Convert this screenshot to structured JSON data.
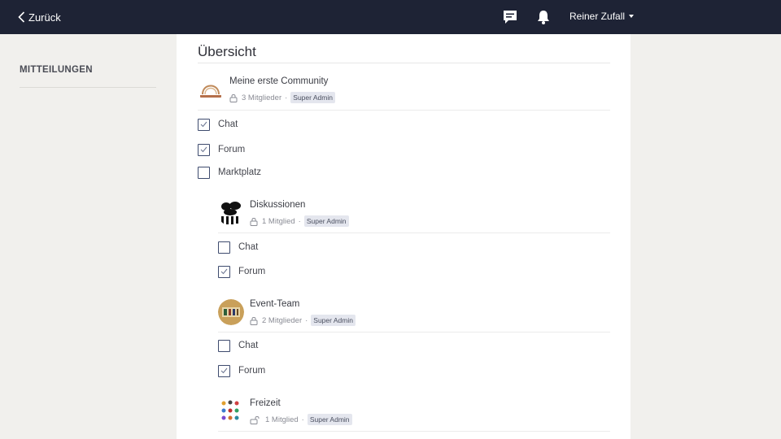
{
  "header": {
    "back_label": "Zurück",
    "user_name": "Reiner Zufall"
  },
  "sidebar": {
    "title": "MITTEILUNGEN"
  },
  "main": {
    "title": "Übersicht",
    "communities": [
      {
        "name": "Meine erste Community",
        "members": "3 Mitglieder",
        "role": "Super Admin",
        "options": [
          {
            "label": "Chat",
            "checked": true
          },
          {
            "label": "Forum",
            "checked": true
          },
          {
            "label": "Marktplatz",
            "checked": false
          }
        ]
      },
      {
        "name": "Diskussionen",
        "members": "1 Mitglied",
        "role": "Super Admin",
        "options": [
          {
            "label": "Chat",
            "checked": false
          },
          {
            "label": "Forum",
            "checked": true
          }
        ]
      },
      {
        "name": "Event-Team",
        "members": "2 Mitglieder",
        "role": "Super Admin",
        "options": [
          {
            "label": "Chat",
            "checked": false
          },
          {
            "label": "Forum",
            "checked": true
          }
        ]
      },
      {
        "name": "Freizeit",
        "members": "1 Mitglied",
        "role": "Super Admin",
        "options": []
      }
    ]
  },
  "colors": {
    "topbar": "#1e2335",
    "checkbox_border": "#3e4b6e",
    "badge_bg": "#e4e6ee"
  }
}
